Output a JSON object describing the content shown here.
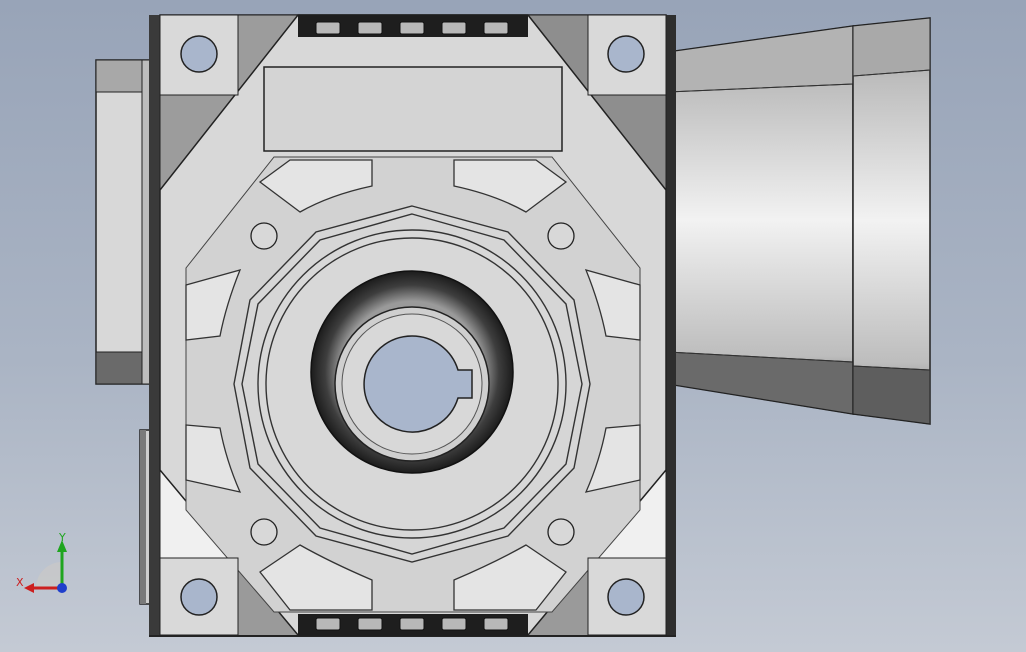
{
  "scene": {
    "background_top": "#98a4b8",
    "background_bottom": "#c4cad4",
    "housing_color": "#d6d6d6",
    "shadow_color": "#5a5a5a",
    "hole_color": "#a9b6cc"
  },
  "triad": {
    "x_label": "X",
    "y_label": "Y",
    "x_color": "#cc1f1f",
    "y_color": "#1fa51f",
    "z_color": "#1f3fcc"
  }
}
